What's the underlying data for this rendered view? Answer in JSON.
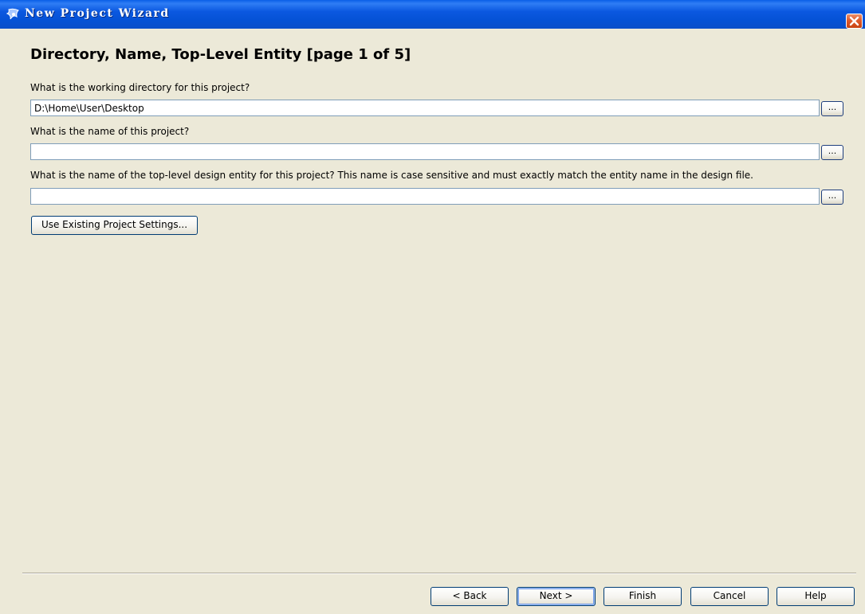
{
  "window": {
    "title": "New Project Wizard",
    "app_icon": "quartus-icon",
    "close_icon": "close-icon"
  },
  "page": {
    "heading": "Directory, Name, Top-Level Entity [page 1 of 5]"
  },
  "fields": [
    {
      "label": "What is the working directory for this project?",
      "value": "D:\\Home\\User\\Desktop",
      "browse_label": "..."
    },
    {
      "label": "What is the name of this project?",
      "value": "",
      "browse_label": "..."
    },
    {
      "label": "What is the name of the top-level design entity for this project? This name is case sensitive and must exactly match the entity name in the design file.",
      "value": "",
      "browse_label": "..."
    }
  ],
  "use_existing_label": "Use Existing Project Settings...",
  "footer": {
    "back_label": "< Back",
    "next_label": "Next >",
    "finish_label": "Finish",
    "cancel_label": "Cancel",
    "help_label": "Help"
  }
}
